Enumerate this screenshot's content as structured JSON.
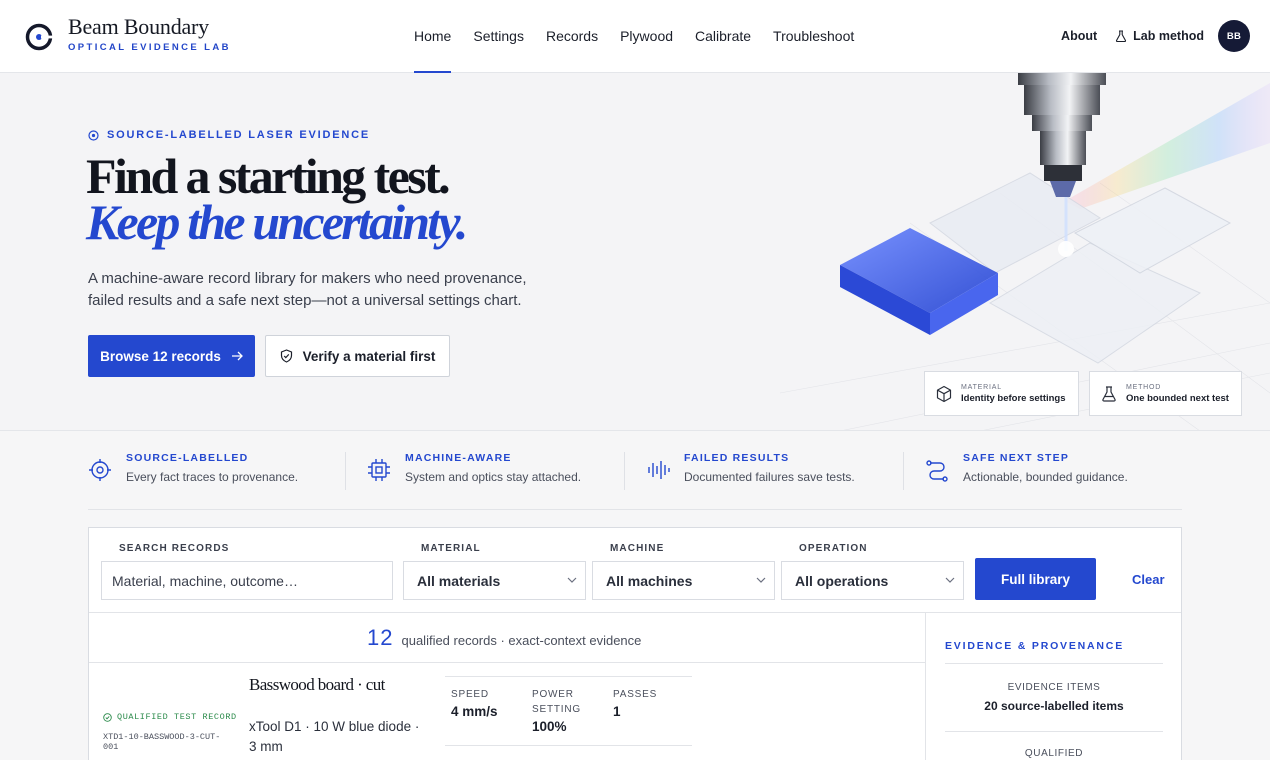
{
  "brand": {
    "name": "Beam Boundary",
    "subtitle": "OPTICAL EVIDENCE LAB"
  },
  "nav": {
    "links": [
      "Home",
      "Settings",
      "Records",
      "Plywood",
      "Calibrate",
      "Troubleshoot"
    ],
    "active": "Home",
    "about": "About",
    "lab_method": "Lab method",
    "avatar_initials": "BB"
  },
  "hero": {
    "eyebrow": "SOURCE-LABELLED LASER EVIDENCE",
    "title_line1": "Find a starting test.",
    "title_line2": "Keep the uncertainty.",
    "description": "A machine-aware record library for makers who need provenance, failed results and a safe next step—not a universal settings chart.",
    "primary_button": "Browse 12 records",
    "secondary_button": "Verify a material first",
    "chips": [
      {
        "key": "MATERIAL",
        "value": "Identity before settings",
        "icon": "cube-icon"
      },
      {
        "key": "METHOD",
        "value": "One bounded next test",
        "icon": "flask-icon"
      }
    ]
  },
  "features": [
    {
      "title": "SOURCE-LABELLED",
      "desc": "Every fact traces to provenance.",
      "icon": "target-icon"
    },
    {
      "title": "MACHINE-AWARE",
      "desc": "System and optics stay attached.",
      "icon": "chip-icon"
    },
    {
      "title": "FAILED RESULTS",
      "desc": "Documented failures save tests.",
      "icon": "waveform-icon"
    },
    {
      "title": "SAFE NEXT STEP",
      "desc": "Actionable, bounded guidance.",
      "icon": "route-icon"
    }
  ],
  "filters": {
    "search_label": "SEARCH RECORDS",
    "search_placeholder": "Material, machine, outcome…",
    "material_label": "MATERIAL",
    "material_value": "All materials",
    "machine_label": "MACHINE",
    "machine_value": "All machines",
    "operation_label": "OPERATION",
    "operation_value": "All operations",
    "full_library": "Full library",
    "clear": "Clear"
  },
  "results": {
    "count": "12",
    "summary": "qualified records · exact-context evidence"
  },
  "record": {
    "badge": "QUALIFIED TEST RECORD",
    "id": "XTD1-10-BASSWOOD-3-CUT-001",
    "title": "Basswood board · cut",
    "machine": "xTool D1 · 10 W blue diode · 3 mm",
    "stats": [
      {
        "key": "SPEED",
        "value": "4 mm/s"
      },
      {
        "key": "POWER SETTING",
        "value": "100%"
      },
      {
        "key": "PASSES",
        "value": "1"
      }
    ]
  },
  "sidebar": {
    "title": "EVIDENCE & PROVENANCE",
    "items_key": "EVIDENCE ITEMS",
    "items_value": "20 source-labelled items",
    "next_key": "QUALIFIED"
  },
  "colors": {
    "accent": "#2448cf",
    "navy": "#151a36",
    "success": "#2a8a4a"
  }
}
